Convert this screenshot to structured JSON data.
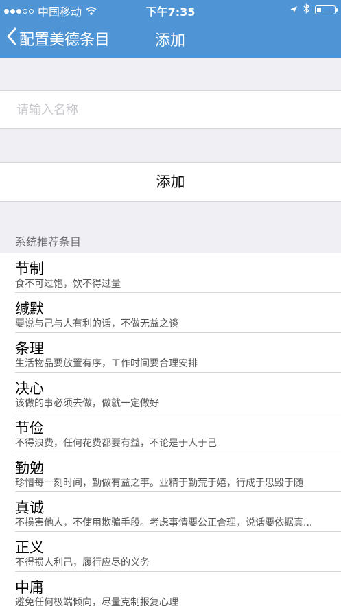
{
  "status_bar": {
    "carrier": "中国移动",
    "time": "下午7:35",
    "signal_bars": 3,
    "icons": [
      "wifi-icon",
      "location-icon",
      "bluetooth-icon",
      "battery-icon"
    ]
  },
  "nav": {
    "back_label": "配置美德条目",
    "title": "添加"
  },
  "form": {
    "name_placeholder": "请输入名称",
    "name_value": "",
    "add_button_label": "添加"
  },
  "recommended": {
    "header": "系统推荐条目",
    "items": [
      {
        "title": "节制",
        "desc": "食不可过饱，饮不得过量"
      },
      {
        "title": "缄默",
        "desc": "要说与己与人有利的话，不做无益之谈"
      },
      {
        "title": "条理",
        "desc": "生活物品要放置有序，工作时间要合理安排"
      },
      {
        "title": "决心",
        "desc": "该做的事必须去做，做就一定做好"
      },
      {
        "title": "节俭",
        "desc": "不得浪费，任何花费都要有益，不论是于人于己"
      },
      {
        "title": "勤勉",
        "desc": "珍惜每一刻时间，勤做有益之事。业精于勤荒于嬉，行成于思毁于随"
      },
      {
        "title": "真诚",
        "desc": "不损害他人，不使用欺骗手段。考虑事情要公正合理，说话要依据真..."
      },
      {
        "title": "正义",
        "desc": "不得损人利己，履行应尽的义务"
      },
      {
        "title": "中庸",
        "desc": "避免任何极端倾向，尽量克制报复心理"
      }
    ]
  },
  "colors": {
    "nav_background": "#4f95d6",
    "page_background": "#efeff4"
  }
}
